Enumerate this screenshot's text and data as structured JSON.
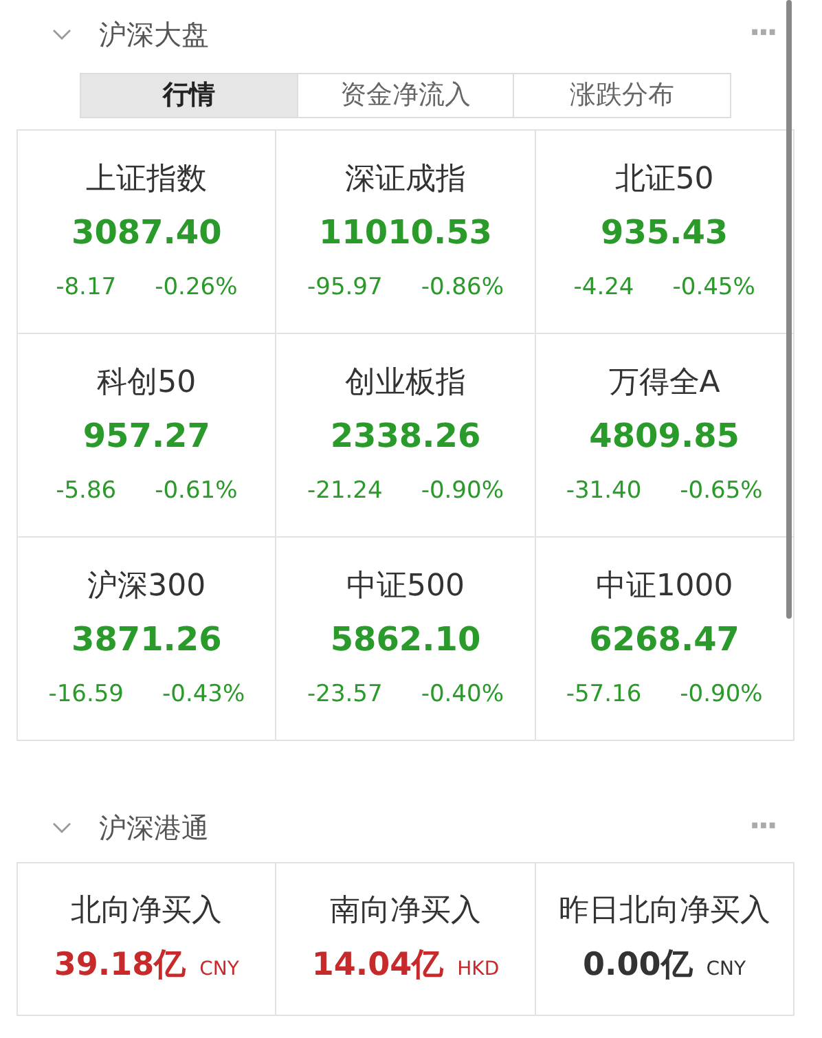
{
  "sections": [
    {
      "title": "沪深大盘",
      "expanded": true,
      "more": "···",
      "tabs": [
        {
          "label": "行情",
          "selected": true
        },
        {
          "label": "资金净流入",
          "selected": false
        },
        {
          "label": "涨跌分布",
          "selected": false
        }
      ],
      "indices": [
        {
          "name": "上证指数",
          "value": "3087.40",
          "change": "-8.17",
          "percent": "-0.26%",
          "color": "#2a9a2a"
        },
        {
          "name": "深证成指",
          "value": "11010.53",
          "change": "-95.97",
          "percent": "-0.86%",
          "color": "#2a9a2a"
        },
        {
          "name": "北证50",
          "value": "935.43",
          "change": "-4.24",
          "percent": "-0.45%",
          "color": "#2a9a2a"
        },
        {
          "name": "科创50",
          "value": "957.27",
          "change": "-5.86",
          "percent": "-0.61%",
          "color": "#2a9a2a"
        },
        {
          "name": "创业板指",
          "value": "2338.26",
          "change": "-21.24",
          "percent": "-0.90%",
          "color": "#2a9a2a"
        },
        {
          "name": "万得全A",
          "value": "4809.85",
          "change": "-31.40",
          "percent": "-0.65%",
          "color": "#2a9a2a"
        },
        {
          "name": "沪深300",
          "value": "3871.26",
          "change": "-16.59",
          "percent": "-0.43%",
          "color": "#2a9a2a"
        },
        {
          "name": "中证500",
          "value": "5862.10",
          "change": "-23.57",
          "percent": "-0.40%",
          "color": "#2a9a2a"
        },
        {
          "name": "中证1000",
          "value": "6268.47",
          "change": "-57.16",
          "percent": "-0.90%",
          "color": "#2a9a2a"
        }
      ]
    },
    {
      "title": "沪深港通",
      "expanded": true,
      "more": "···",
      "flows": [
        {
          "name": "北向净买入",
          "value": "39.18亿",
          "currency": "CNY",
          "color": "#c62a2a"
        },
        {
          "name": "南向净买入",
          "value": "14.04亿",
          "currency": "HKD",
          "color": "#c62a2a"
        },
        {
          "name": "昨日北向净买入",
          "value": "0.00亿",
          "currency": "CNY",
          "color": "#333333"
        }
      ]
    }
  ]
}
